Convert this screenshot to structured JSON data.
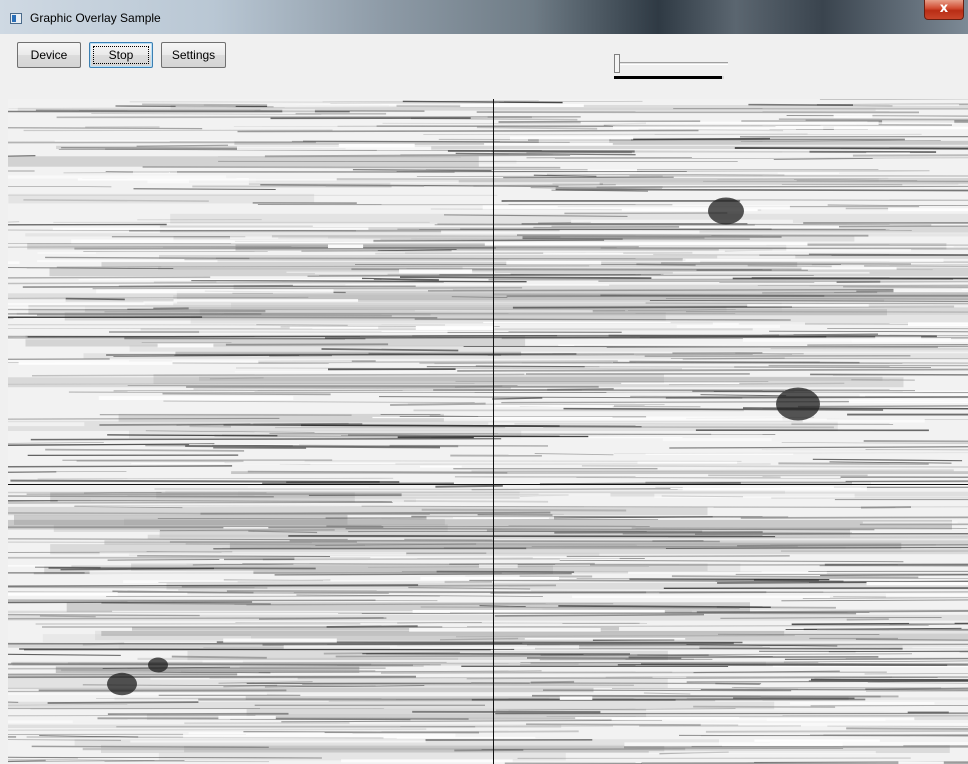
{
  "window": {
    "title": "Graphic Overlay Sample",
    "close_label": "x",
    "icons": {
      "app": "app-window-icon",
      "close": "close-icon"
    }
  },
  "toolbar": {
    "device_label": "Device",
    "stop_label": "Stop",
    "settings_label": "Settings"
  },
  "slider": {
    "value": 0.0,
    "progress_fraction": 0.98
  },
  "video": {
    "overlay": "crosshair",
    "colors": {
      "crosshair": "#111111"
    }
  }
}
